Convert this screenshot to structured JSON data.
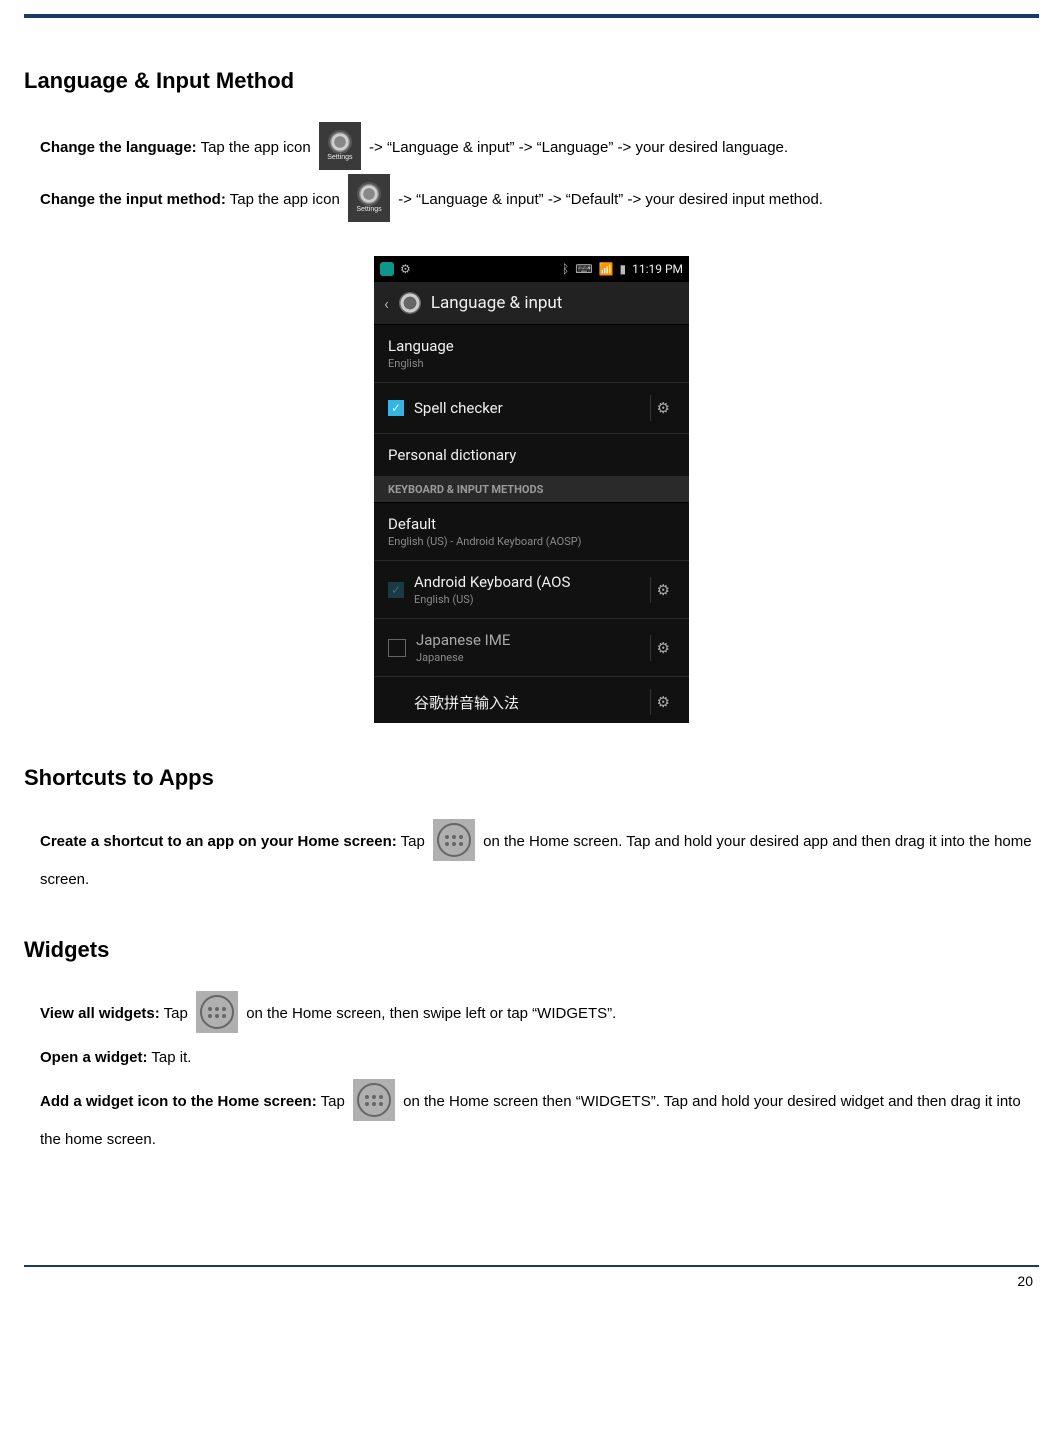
{
  "page_number": "20",
  "section1": {
    "title": "Language & Input Method",
    "change_language_bold": "Change the language:",
    "change_language_pre": " Tap the app icon ",
    "change_language_post": " -> “Language & input” -> “Language” -> your desired language.",
    "change_input_bold": "Change the input method:",
    "change_input_pre": " Tap the app icon ",
    "change_input_post": " -> “Language & input” -> “Default” -> your desired input method.",
    "settings_icon_label": "Settings"
  },
  "phone": {
    "time": "11:19 PM",
    "header_title": "Language & input",
    "rows": {
      "language_label": "Language",
      "language_value": "English",
      "spell_checker": "Spell checker",
      "personal_dict": "Personal dictionary",
      "keyboard_header": "KEYBOARD & INPUT METHODS",
      "default_label": "Default",
      "default_value": "English (US) - Android Keyboard (AOSP)",
      "android_kb_label": "Android Keyboard (AOS",
      "android_kb_sub": "English (US)",
      "jp_label": "Japanese IME",
      "jp_sub": "Japanese",
      "pinyin_label": "谷歌拼音输入法"
    }
  },
  "section2": {
    "title": "Shortcuts to Apps",
    "create_bold": "Create a shortcut to an app on your Home screen:",
    "create_pre": " Tap ",
    "create_post": " on the Home screen. Tap and hold your desired app and then drag it into the home screen."
  },
  "section3": {
    "title": "Widgets",
    "view_bold": "View all widgets:",
    "view_pre": " Tap ",
    "view_post": " on the Home screen, then swipe left or tap “WIDGETS”.",
    "open_bold": "Open a widget:",
    "open_rest": " Tap it.",
    "add_bold": "Add a widget icon to the Home screen:",
    "add_pre": " Tap ",
    "add_post": " on the Home screen then “WIDGETS”. Tap and hold your desired widget and then drag it into the home screen."
  }
}
